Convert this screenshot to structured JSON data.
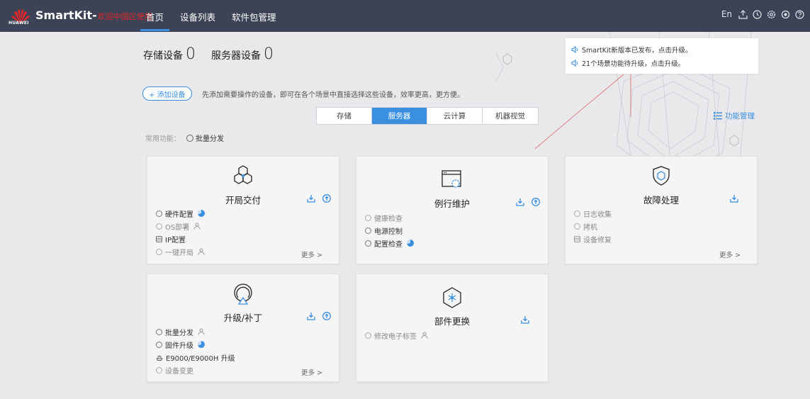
{
  "header": {
    "brand_text": "SmartKit-",
    "brand_sub": "欢迎中国区使用",
    "logo_text": "HUAWEI",
    "nav": [
      "首页",
      "设备列表",
      "软件包管理"
    ],
    "nav_active": 0,
    "lang": "En",
    "right_icons": [
      "upload-icon",
      "history-icon",
      "settings-icon",
      "gear-icon",
      "help-icon"
    ]
  },
  "counts": {
    "storage_label": "存储设备",
    "storage_value": "0",
    "server_label": "服务器设备",
    "server_value": "0"
  },
  "notices": [
    "SmartKit新版本已发布，点击升级。",
    "21个场景功能待升级，点击升级。"
  ],
  "add_device": {
    "label": "+ 添加设备",
    "hint": "先添加需要操作的设备，即可在各个场景中直接选择这些设备，效率更高，更方便。"
  },
  "tabs": [
    "存储",
    "服务器",
    "云计算",
    "机器视觉"
  ],
  "tab_active": 1,
  "func_mgmt": "功能管理",
  "common_label": "常用功能：",
  "common_item": "批量分发",
  "more_label": "更多 >",
  "colors": {
    "accent": "#3a8fe0",
    "topbar": "#3d4356",
    "brand_red": "#e0262a"
  },
  "cards": [
    {
      "title": "开局交付",
      "icon": "hexagon-cluster-icon",
      "items": [
        {
          "label": "硬件配置",
          "marker": "circle",
          "extra": "pie",
          "dim": false
        },
        {
          "label": "OS部署",
          "marker": "circle",
          "extra": "person",
          "dim": true
        },
        {
          "label": "IP配置",
          "marker": "db",
          "extra": "",
          "dim": false
        },
        {
          "label": "一键开局",
          "marker": "circle",
          "extra": "person",
          "dim": true
        }
      ],
      "more": true,
      "actions": [
        "download",
        "upgrade"
      ]
    },
    {
      "title": "例行维护",
      "icon": "maintenance-window-icon",
      "items": [
        {
          "label": "健康检查",
          "marker": "circle",
          "extra": "",
          "dim": true
        },
        {
          "label": "电源控制",
          "marker": "circle",
          "extra": "",
          "dim": false
        },
        {
          "label": "配置检查",
          "marker": "circle",
          "extra": "pie",
          "dim": false
        }
      ],
      "more": false,
      "actions": [
        "download",
        "upgrade"
      ]
    },
    {
      "title": "故障处理",
      "icon": "shield-icon",
      "items": [
        {
          "label": "日志收集",
          "marker": "circle",
          "extra": "",
          "dim": true
        },
        {
          "label": "拷机",
          "marker": "circle",
          "extra": "",
          "dim": true
        },
        {
          "label": "设备修复",
          "marker": "db",
          "extra": "",
          "dim": true
        }
      ],
      "more": true,
      "actions": [
        "download"
      ]
    },
    {
      "title": "升级/补丁",
      "icon": "upgrade-ring-icon",
      "items": [
        {
          "label": "批量分发",
          "marker": "circle",
          "extra": "person",
          "dim": false
        },
        {
          "label": "固件升级",
          "marker": "circle",
          "extra": "pie",
          "dim": false
        },
        {
          "label": "E9000/E9000H 升级",
          "marker": "boat",
          "extra": "",
          "dim": false
        },
        {
          "label": "设备变更",
          "marker": "circle",
          "extra": "",
          "dim": true
        }
      ],
      "more": true,
      "actions": [
        "download",
        "upgrade"
      ]
    },
    {
      "title": "部件更换",
      "icon": "component-hexagon-icon",
      "items": [
        {
          "label": "修改电子标签",
          "marker": "circle",
          "extra": "person",
          "dim": true
        }
      ],
      "more": false,
      "actions": [
        "download"
      ]
    }
  ]
}
